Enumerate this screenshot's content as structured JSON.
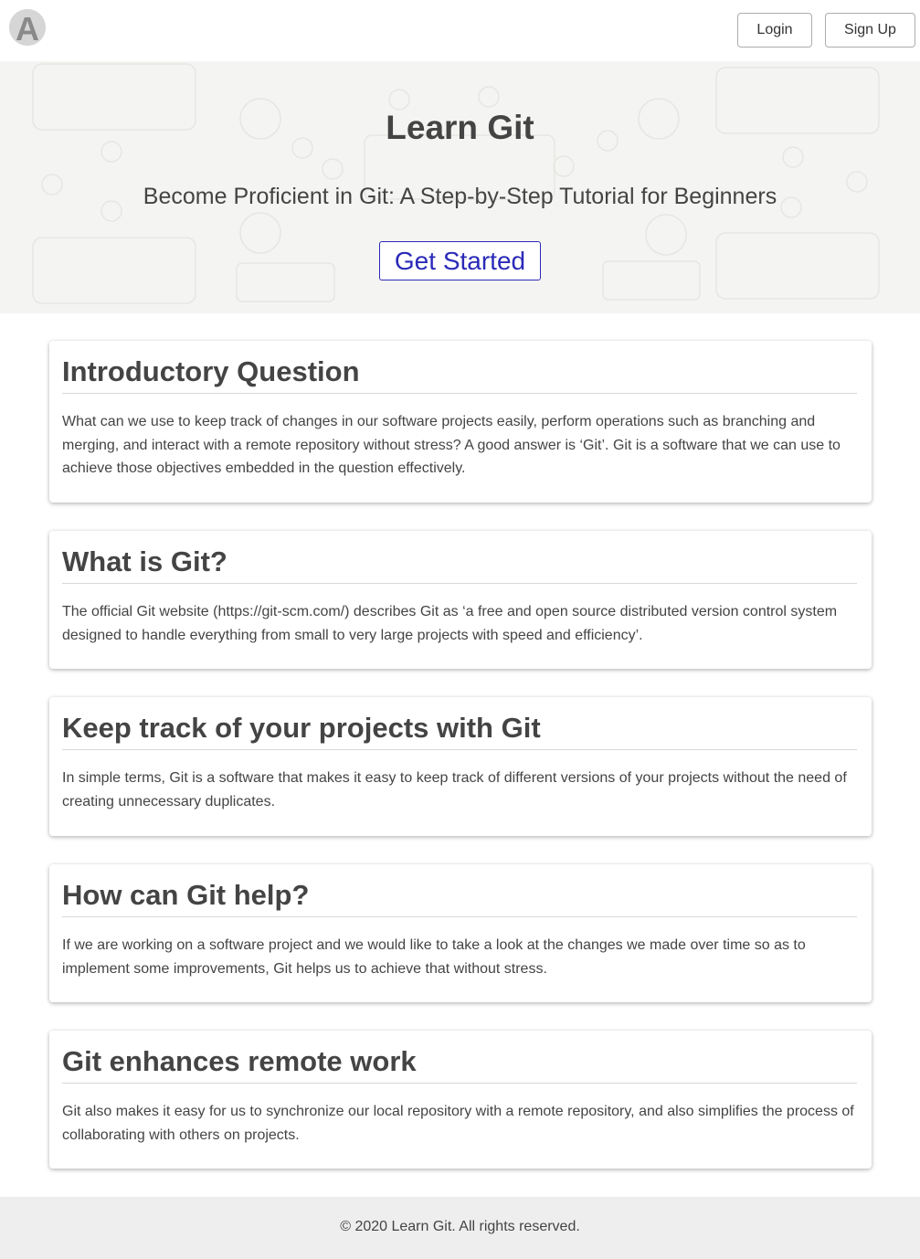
{
  "header": {
    "logo_letter": "A",
    "login_label": "Login",
    "signup_label": "Sign Up"
  },
  "hero": {
    "title": "Learn Git",
    "subtitle": "Become Proficient in Git: A Step-by-Step Tutorial for Beginners",
    "cta_label": "Get Started"
  },
  "sections": [
    {
      "title": "Introductory Question",
      "body": "What can we use to keep track of changes in our software projects easily, perform operations such as branching and merging, and interact with a remote repository without stress? A good answer is ‘Git’. Git is a software that we can use to achieve those objectives embedded in the question effectively."
    },
    {
      "title": "What is Git?",
      "body": "The official Git website (https://git-scm.com/) describes Git as ‘a free and open source distributed version control system designed to handle everything from small to very large projects with speed and efficiency’."
    },
    {
      "title": "Keep track of your projects with Git",
      "body": "In simple terms, Git is a software that makes it easy to keep track of different versions of your projects without the need of creating unnecessary duplicates."
    },
    {
      "title": "How can Git help?",
      "body": "If we are working on a software project and we would like to take a look at the changes we made over time so as to implement some improvements, Git helps us to achieve that without stress."
    },
    {
      "title": "Git enhances remote work",
      "body": "Git also makes it easy for us to synchronize our local repository with a remote repository, and also simplifies the process of collaborating with others on projects."
    }
  ],
  "footer": {
    "copyright": "© 2020 Learn Git. All rights reserved."
  },
  "colors": {
    "hero_background": "#f4f4f2",
    "cta_accent": "#2a2ab8",
    "footer_background": "#eeeeee",
    "text": "#444444"
  },
  "icons": {
    "logo": "letter-a-logo-icon"
  }
}
